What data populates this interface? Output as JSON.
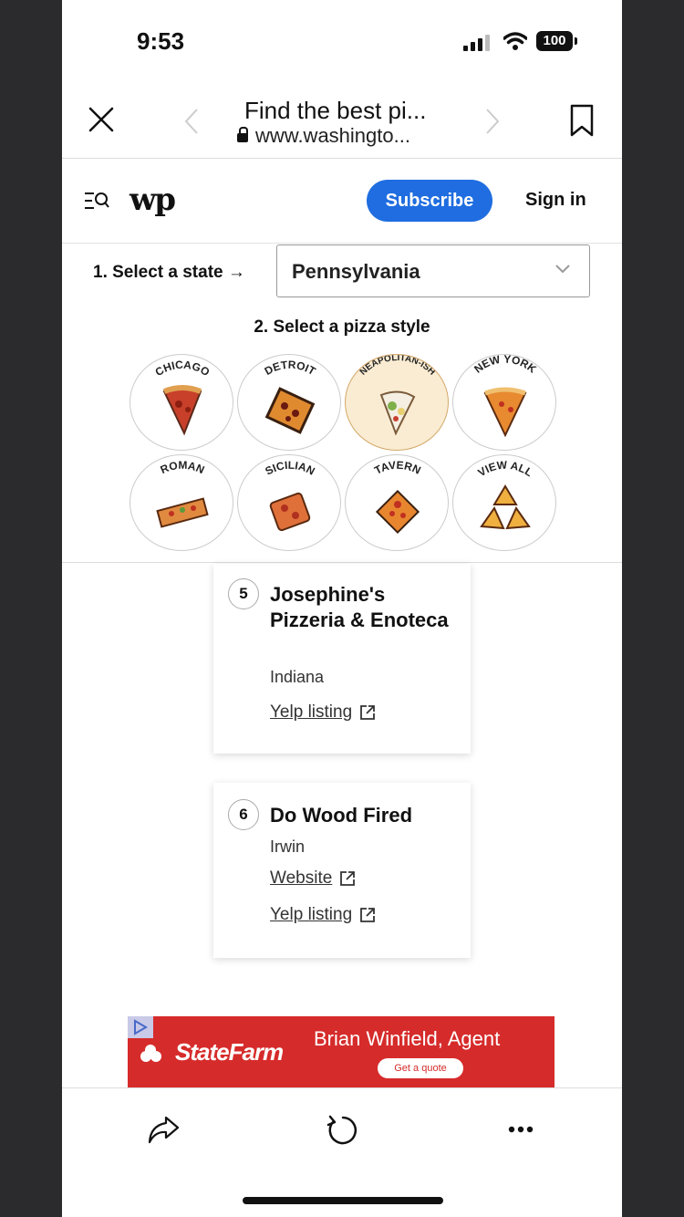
{
  "status": {
    "time": "9:53",
    "battery": "100"
  },
  "browser": {
    "title": "Find the best pi...",
    "url": "www.washingto..."
  },
  "header": {
    "logo": "wp",
    "subscribe_label": "Subscribe",
    "signin_label": "Sign in"
  },
  "selectors": {
    "state_label": "1. Select a state →",
    "state_value": "Pennsylvania",
    "style_label": "2. Select a pizza style"
  },
  "styles": [
    {
      "label": "CHICAGO",
      "active": false
    },
    {
      "label": "DETROIT",
      "active": false
    },
    {
      "label": "NEAPOLITAN-ISH",
      "active": true
    },
    {
      "label": "NEW YORK",
      "active": false
    },
    {
      "label": "ROMAN",
      "active": false
    },
    {
      "label": "SICILIAN",
      "active": false
    },
    {
      "label": "TAVERN",
      "active": false
    },
    {
      "label": "VIEW ALL",
      "active": false
    }
  ],
  "results": [
    {
      "number": "5",
      "name": "Josephine's Pizzeria & Enoteca",
      "city": "Indiana",
      "links": [
        "Yelp listing"
      ]
    },
    {
      "number": "6",
      "name": "Do Wood Fired",
      "city": "Irwin",
      "links": [
        "Website",
        "Yelp listing"
      ]
    }
  ],
  "ad": {
    "brand": "StateFarm",
    "agent": "Brian Winfield, Agent",
    "cta": "Get a quote"
  },
  "colors": {
    "accent": "#1f6de0",
    "ad_red": "#d62b2b",
    "active_style_bg": "#f9ecd2"
  }
}
